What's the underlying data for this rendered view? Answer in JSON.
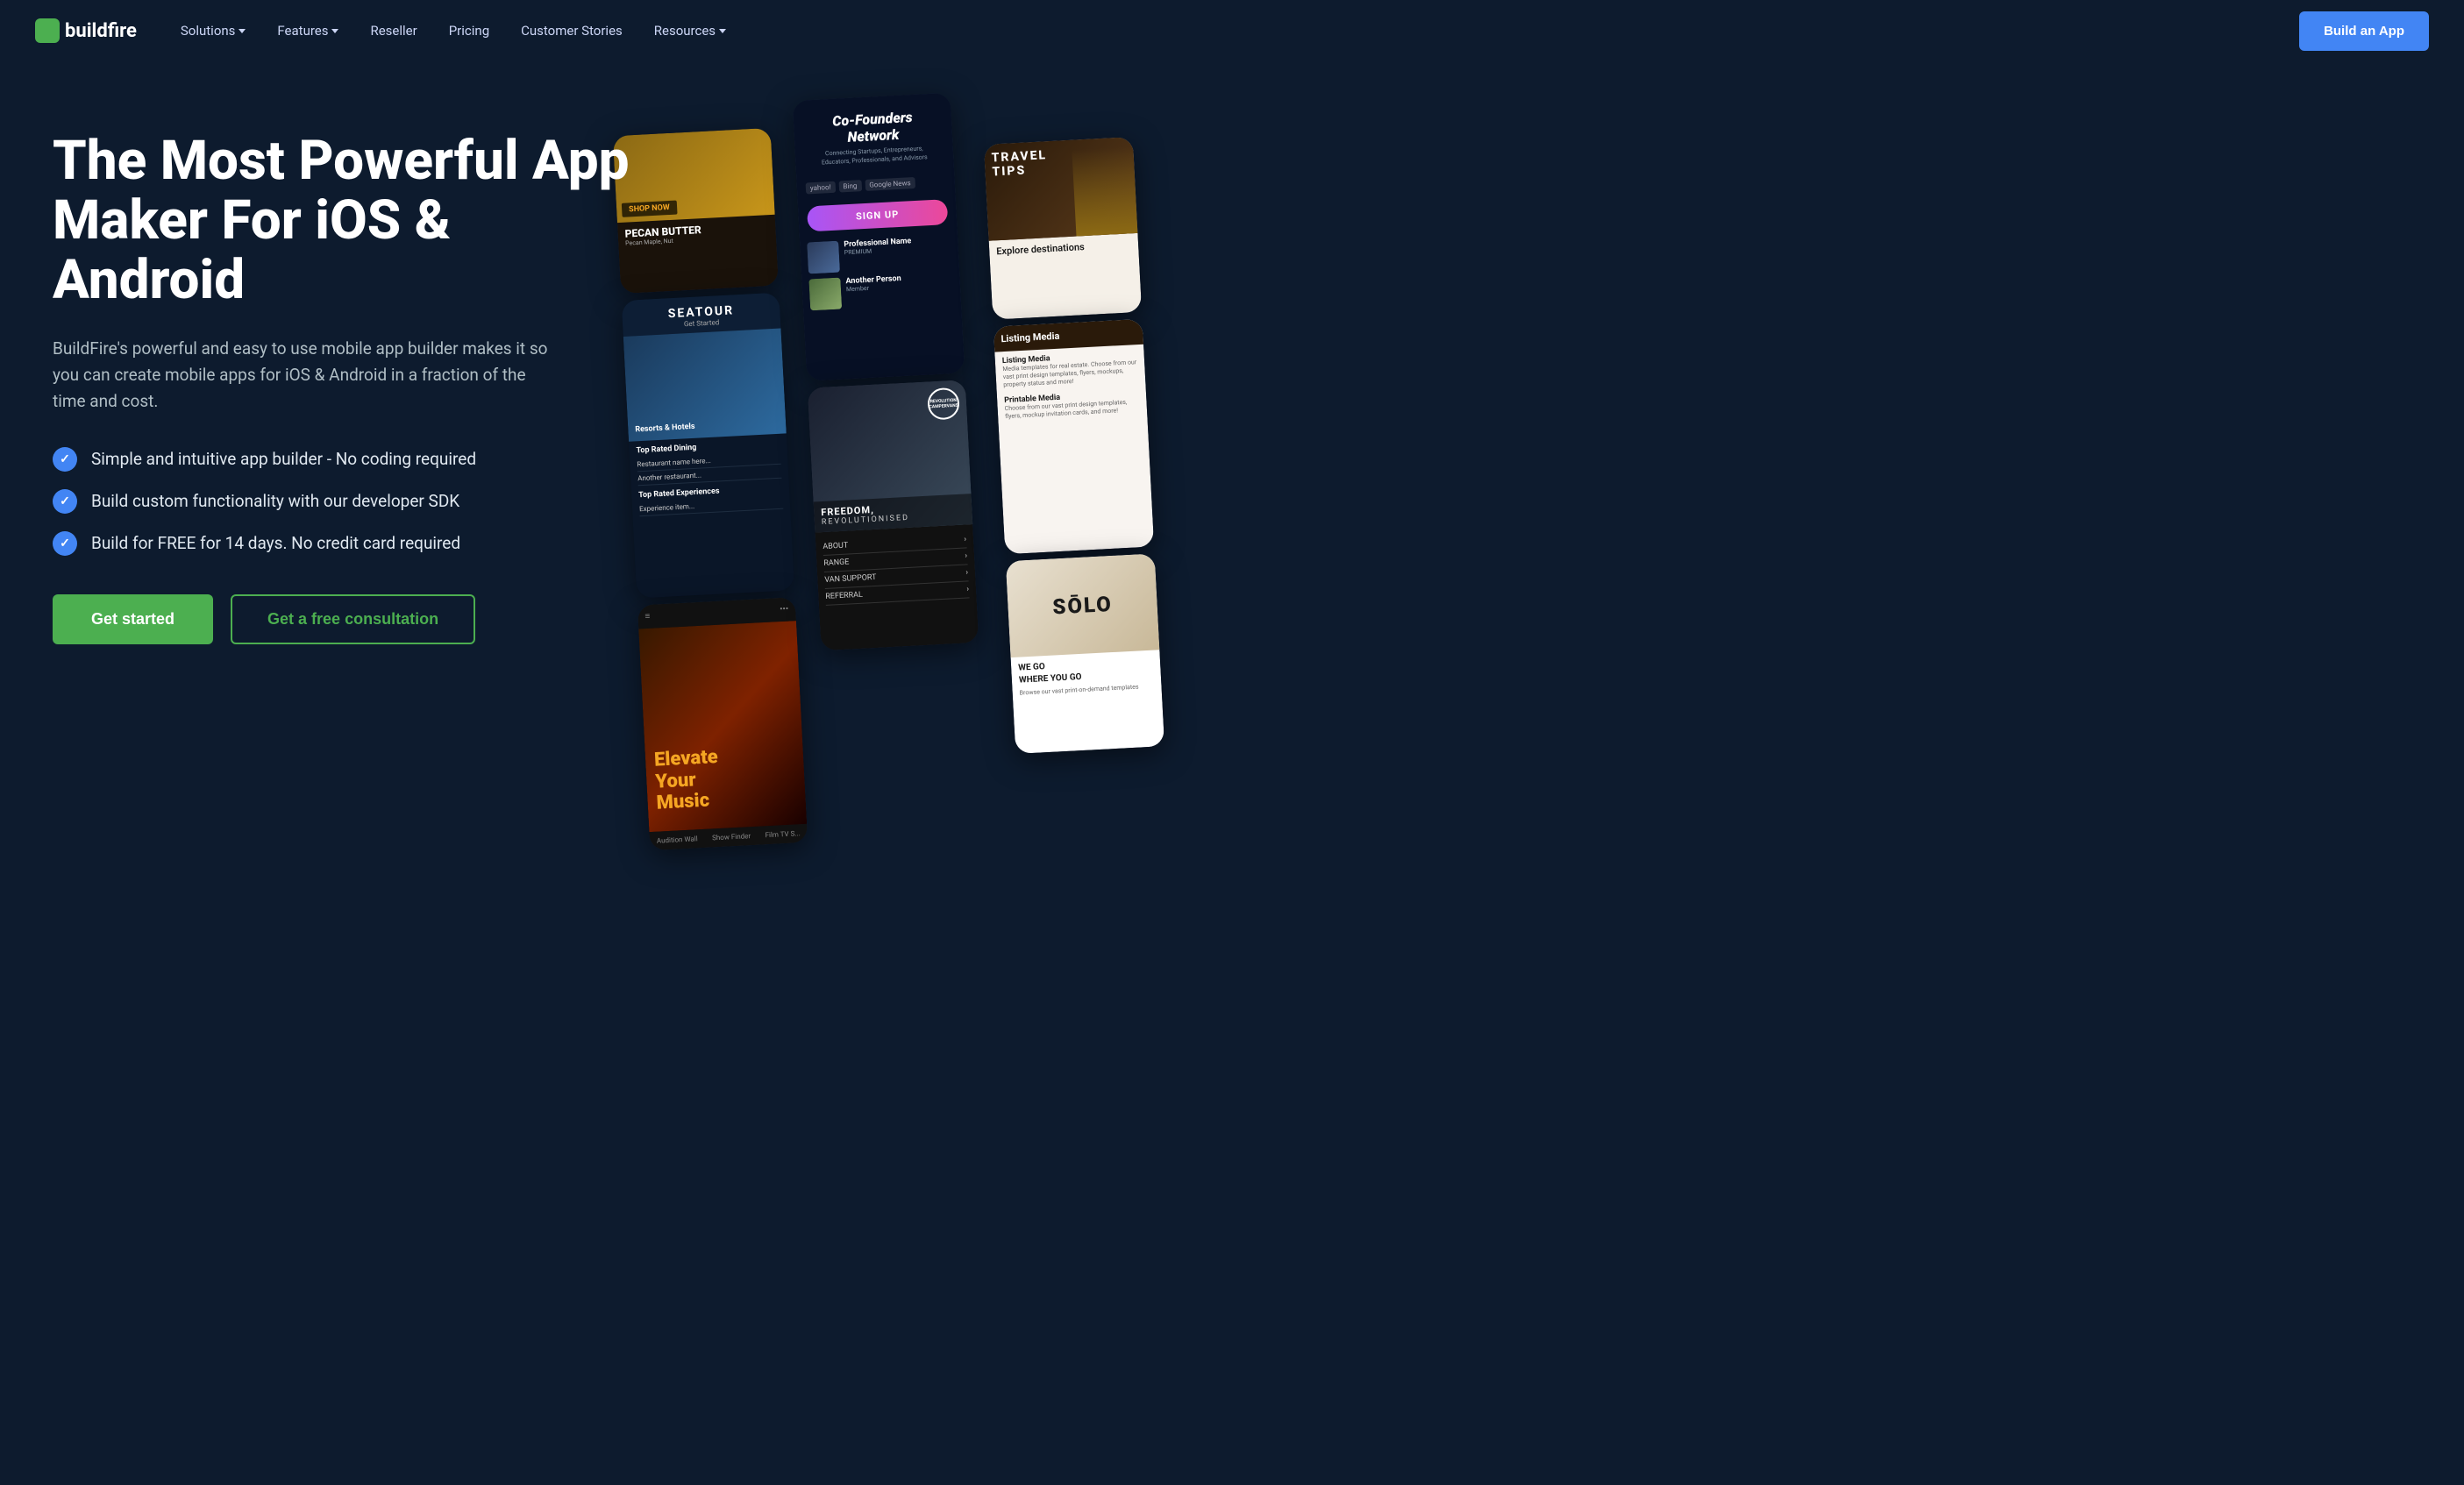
{
  "nav": {
    "logo": "buildfire",
    "links": [
      {
        "label": "Solutions",
        "hasDropdown": true
      },
      {
        "label": "Features",
        "hasDropdown": true
      },
      {
        "label": "Reseller",
        "hasDropdown": false
      },
      {
        "label": "Pricing",
        "hasDropdown": false
      },
      {
        "label": "Customer Stories",
        "hasDropdown": false
      },
      {
        "label": "Resources",
        "hasDropdown": true
      }
    ],
    "cta_label": "Build an App"
  },
  "hero": {
    "title": "The Most Powerful App Maker For iOS & Android",
    "subtitle": "BuildFire's powerful and easy to use mobile app builder makes it so you can create mobile apps for iOS & Android in a fraction of the time and cost.",
    "features": [
      "Simple and intuitive app builder - No coding required",
      "Build custom functionality with our developer SDK",
      "Build for FREE for 14 days. No credit card required"
    ],
    "btn_primary": "Get started",
    "btn_secondary": "Get a free consultation"
  },
  "apps": {
    "pecan": {
      "shop_label": "SHOP NOW",
      "title": "PECAN BUTTER",
      "sub": "Pecan Maple, Nut"
    },
    "seatour": {
      "name": "SEATOUR",
      "subtitle": "Get Started",
      "list_header": "Top Rated Dining",
      "list_header2": "Top Rated Experiences"
    },
    "music": {
      "title": "Elevate\nYour\nMusic",
      "bottom1": "Audition Wall",
      "bottom2": "Show Finder",
      "bottom3": "Film TV S..."
    },
    "cfn": {
      "title": "Co-Founders\nNetwork",
      "desc": "Connecting Startups, Entrepreneurs,\nEducators, Professionals, and Advisors",
      "signup": "SIGN UP",
      "logos": [
        "yahoo!",
        "Bing",
        "Google News"
      ]
    },
    "camper": {
      "brand": "REVOLUTION\nCAMPERVANS",
      "freedom": "FREEDOM,",
      "revolutionised": "REVOLUTIONISED",
      "menu": [
        "ABOUT",
        "RANGE",
        "VAN SUPPORT",
        "REFERRAL"
      ]
    },
    "travel_tips": {
      "label": "TRAVEL\nTIPS"
    },
    "listing": {
      "header": "Listing Media",
      "desc": "Media templates for real estate"
    },
    "solo": {
      "brand": "SŌLO",
      "tagline": "WE GO\nWHERE YOU GO",
      "sub": "Browse our vast print-on-demand templates"
    }
  },
  "colors": {
    "bg": "#0d1b2e",
    "accent_blue": "#4285f4",
    "accent_green": "#4CAF50",
    "text_primary": "#ffffff",
    "text_secondary": "#b0bec5"
  }
}
